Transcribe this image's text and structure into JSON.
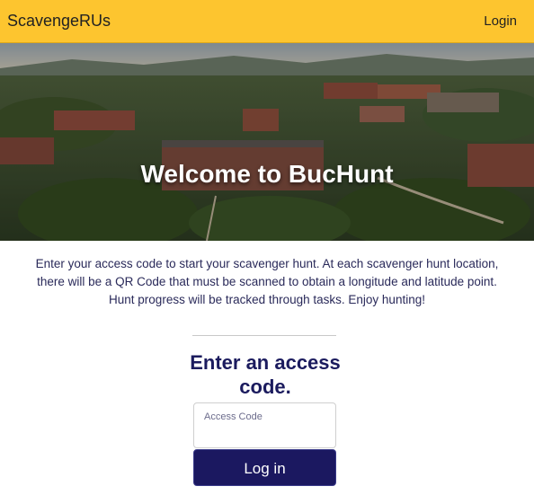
{
  "navbar": {
    "brand": "ScavengeRUs",
    "login_link": "Login",
    "background": "#FDC52F"
  },
  "hero": {
    "title": "Welcome to BucHunt"
  },
  "intro": {
    "text": "Enter your access code to start your scavenger hunt. At each scavenger hunt location, there will be a QR Code that must be scanned to obtain a longitude and latitude point. Hunt progress will be tracked through tasks. Enjoy hunting!"
  },
  "form": {
    "heading": "Enter an access code.",
    "access_code_label": "Access Code",
    "access_code_value": "",
    "submit_label": "Log in",
    "button_color": "#1b1860"
  }
}
